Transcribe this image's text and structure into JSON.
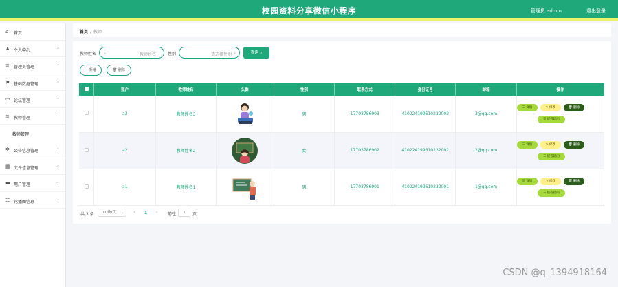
{
  "header": {
    "title": "校园资料分享微信小程序",
    "admin": "管理员 admin",
    "logout": "退出登录"
  },
  "sidebar": {
    "items": [
      {
        "label": "首页",
        "icon": "home-icon",
        "glyph": "⌂"
      },
      {
        "label": "个人中心",
        "icon": "user-icon",
        "glyph": "♟"
      },
      {
        "label": "管理员管理",
        "icon": "list-icon",
        "glyph": "≡"
      },
      {
        "label": "基础数据管理",
        "icon": "flag-icon",
        "glyph": "⚑"
      },
      {
        "label": "论坛管理",
        "icon": "forum-icon",
        "glyph": "▭"
      },
      {
        "label": "教师管理",
        "icon": "list-icon",
        "glyph": "≡"
      },
      {
        "label": "公告信息管理",
        "icon": "gear-icon",
        "glyph": "✲"
      },
      {
        "label": "文件信息管理",
        "icon": "grid-icon",
        "glyph": "▦"
      },
      {
        "label": "用户管理",
        "icon": "monitor-icon",
        "glyph": "▬"
      },
      {
        "label": "轮播图信息",
        "icon": "settings-icon",
        "glyph": "☷"
      }
    ],
    "sub_item": "教师管理"
  },
  "breadcrumb": {
    "home": "首页",
    "sep": "/",
    "current": "教师"
  },
  "search": {
    "name_label": "教师姓名",
    "name_placeholder": "教师姓名",
    "gender_label": "性别",
    "gender_placeholder": "请选择性别",
    "button": "查询 ⌕"
  },
  "actions": {
    "add": "+ 新增",
    "delete": "🗑 删除"
  },
  "table": {
    "headers": [
      "账户",
      "教师姓名",
      "头像",
      "性别",
      "联系方式",
      "身份证号",
      "邮箱",
      "操作"
    ],
    "rows": [
      {
        "account": "a3",
        "name": "教师姓名3",
        "gender": "男",
        "phone": "17703786903",
        "idno": "410224199610232003",
        "email": "3@qq.com"
      },
      {
        "account": "a2",
        "name": "教师姓名2",
        "gender": "女",
        "phone": "17703786902",
        "idno": "410224199610232002",
        "email": "2@qq.com"
      },
      {
        "account": "a1",
        "name": "教师姓名1",
        "gender": "男",
        "phone": "17703786901",
        "idno": "410224199610232001",
        "email": "1@qq.com"
      }
    ],
    "ops": {
      "detail": "☰ 详情",
      "modify": "✎ 修改",
      "delete": "🗑 删除",
      "answer": "☰ 提答疑问"
    }
  },
  "pager": {
    "total": "共 3 条",
    "size": "10条/页",
    "prev": "‹",
    "page": "1",
    "next": "›",
    "goto": "前往",
    "goto_val": "1",
    "unit": "页"
  },
  "watermark": "CSDN @q_1394918164",
  "colors": {
    "primary": "#1fa97a",
    "accent_bar": "#e8f56a",
    "detail": "#a6d93a",
    "modify": "#fff08a",
    "delete": "#2d5d1a"
  }
}
